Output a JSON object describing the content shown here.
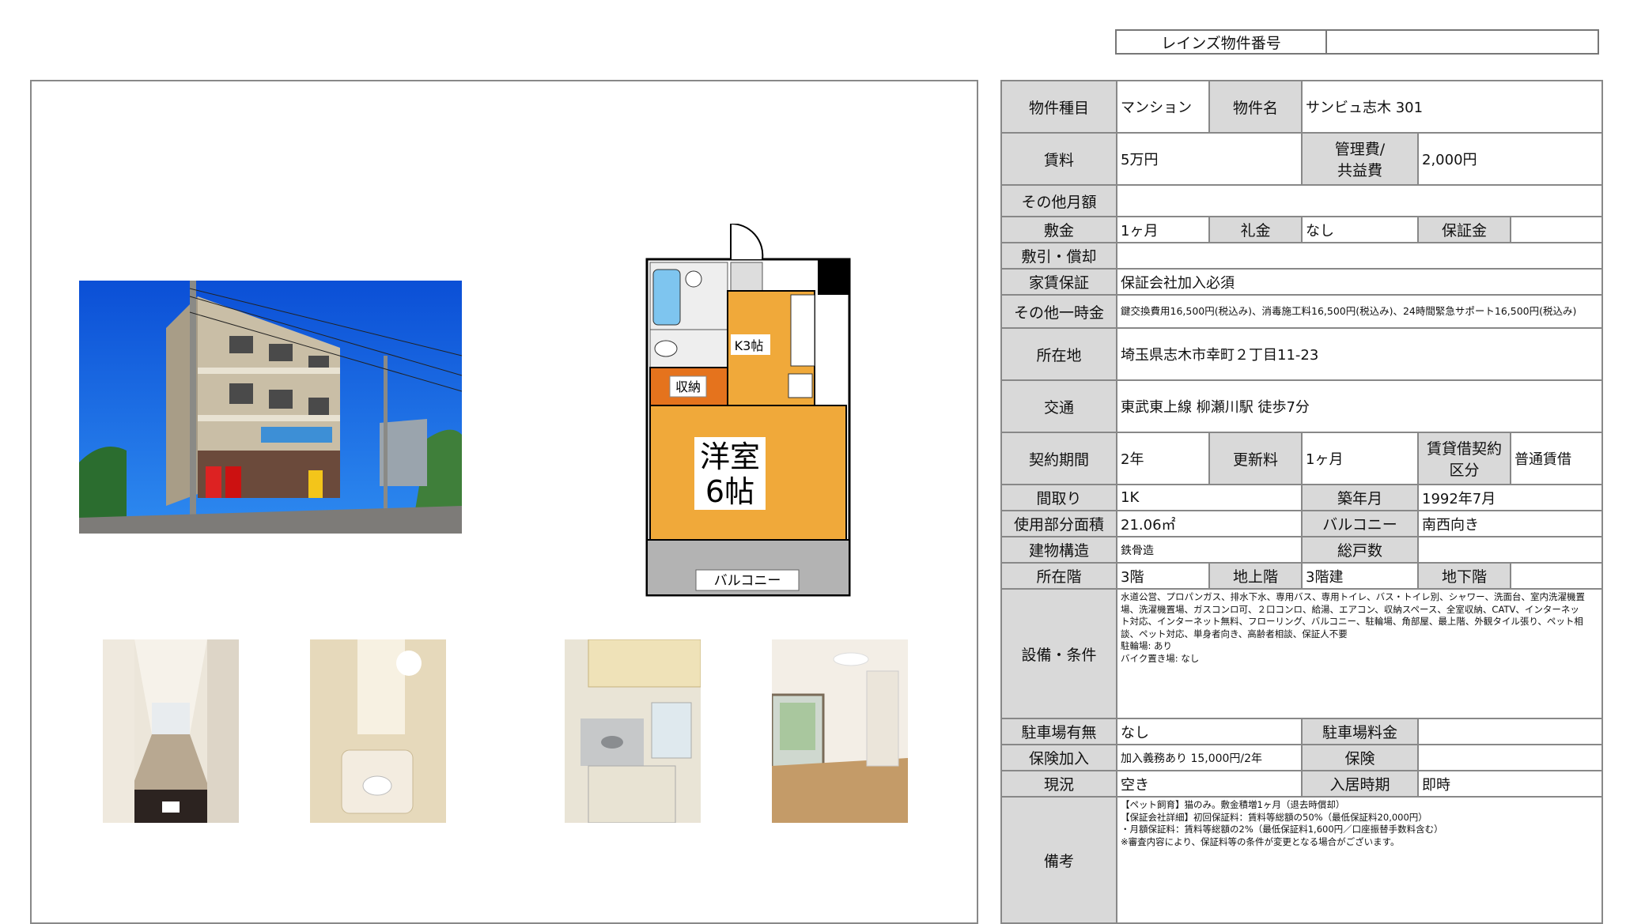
{
  "reins": {
    "label": "レインズ物件番号",
    "value": ""
  },
  "images": {
    "exterior": "building-exterior-photo",
    "floorplan_rooms": {
      "room": "洋室",
      "room_size": "6帖",
      "kitchen": "K3帖",
      "storage": "収納",
      "balcony": "バルコニー"
    }
  },
  "info": {
    "type_label": "物件種目",
    "type_value": "マンション",
    "name_label": "物件名",
    "name_value": "サンビュ志木 301",
    "rent_label": "賃料",
    "rent_value": "5万円",
    "fee_label_1": "管理費/",
    "fee_label_2": "共益費",
    "fee_value": "2,000円",
    "other_monthly_label": "その他月額",
    "other_monthly_value": "",
    "deposit_label": "敷金",
    "deposit_value": "1ヶ月",
    "key_money_label": "礼金",
    "key_money_value": "なし",
    "guarantee_money_label": "保証金",
    "guarantee_money_value": "",
    "deduction_label": "敷引・償却",
    "deduction_value": "",
    "rent_guarantee_label": "家賃保証",
    "rent_guarantee_value": "保証会社加入必須",
    "other_once_label": "その他一時金",
    "other_once_value": "鍵交換費用16,500円(税込み)、消毒施工料16,500円(税込み)、24時間緊急サポート16,500円(税込み)",
    "address_label": "所在地",
    "address_value": "埼玉県志木市幸町２丁目11-23",
    "transport_label": "交通",
    "transport_value": "東武東上線 柳瀬川駅 徒歩7分",
    "term_label": "契約期間",
    "term_value": "2年",
    "renewal_label": "更新料",
    "renewal_value": "1ヶ月",
    "contract_type_label_1": "賃貸借契約",
    "contract_type_label_2": "区分",
    "contract_type_value": "普通賃借",
    "layout_label": "間取り",
    "layout_value": "1K",
    "built_label": "築年月",
    "built_value": "1992年7月",
    "area_label": "使用部分面積",
    "area_value": "21.06㎡",
    "balcony_label": "バルコニー",
    "balcony_value": "南西向き",
    "structure_label": "建物構造",
    "structure_value": "鉄骨造",
    "units_label": "総戸数",
    "units_value": "",
    "floor_label": "所在階",
    "floor_value": "3階",
    "above_label": "地上階",
    "above_value": "3階建",
    "below_label": "地下階",
    "below_value": "",
    "equipment_label": "設備・条件",
    "equipment_lines": [
      "水道公営、プロパンガス、排水下水、専用バス、専用トイレ、バス・トイレ別、シャワー、洗面台、室内洗濯機置",
      "場、洗濯機置場、ガスコンロ可、２口コンロ、給湯、エアコン、収納スペース、全室収納、CATV、インターネッ",
      "ト対応、インターネット無料、フローリング、バルコニー、駐輪場、角部屋、最上階、外観タイル張り、ペット相",
      "談、ペット対応、単身者向き、高齢者相談、保証人不要",
      "駐輪場: あり",
      "バイク置き場: なし"
    ],
    "parking_label": "駐車場有無",
    "parking_value": "なし",
    "parking_fee_label": "駐車場料金",
    "parking_fee_value": "",
    "insurance_join_label": "保険加入",
    "insurance_join_value": "加入義務あり 15,000円/2年",
    "insurance_label": "保険",
    "insurance_value": "",
    "status_label": "現況",
    "status_value": "空き",
    "movein_label": "入居時期",
    "movein_value": "即時",
    "notes_label": "備考",
    "notes_lines": [
      "【ペット飼育】猫のみ。敷金積増1ヶ月（退去時償却）",
      "【保証会社詳細】初回保証料：賃料等総額の50%（最低保証料20,000円）",
      "・月額保証料：賃料等総額の2%（最低保証料1,600円／口座振替手数料含む）",
      "※審査内容により、保証料等の条件が変更となる場合がございます。"
    ]
  }
}
